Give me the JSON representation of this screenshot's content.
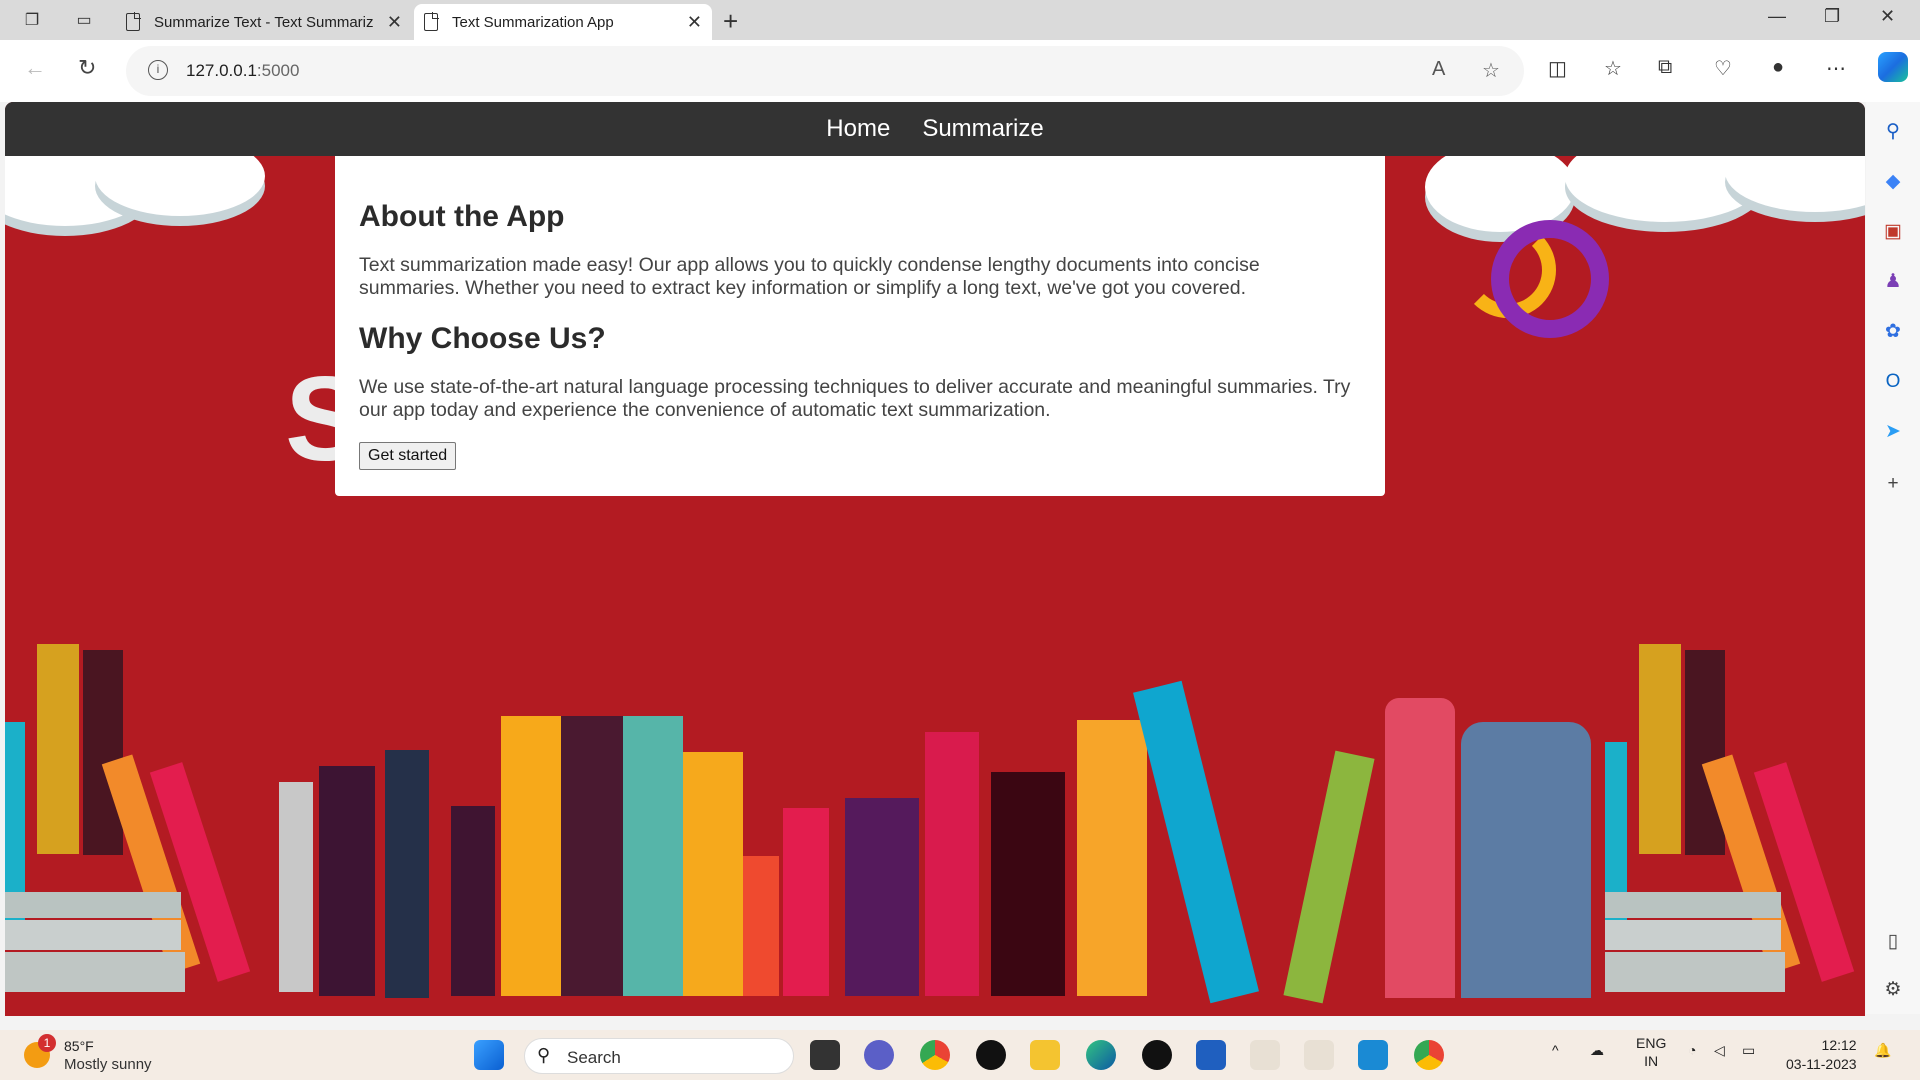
{
  "browser": {
    "tabs": [
      {
        "title": "Summarize Text - Text Summariz",
        "active": false
      },
      {
        "title": "Text Summarization App",
        "active": true
      }
    ],
    "url_host": "127.0.0.1",
    "url_port": ":5000"
  },
  "page": {
    "nav": [
      "Home",
      "Summarize"
    ],
    "bg_text": "SU",
    "about_heading": "About the App",
    "about_text": "Text summarization made easy! Our app allows you to quickly condense lengthy documents into concise summaries. Whether you need to extract key information or simplify a long text, we've got you covered.",
    "why_heading": "Why Choose Us?",
    "why_text": "We use state-of-the-art natural language processing techniques to deliver accurate and meaningful summaries. Try our app today and experience the convenience of automatic text summarization.",
    "button_label": "Get started"
  },
  "taskbar": {
    "weather_badge": "1",
    "temperature": "85°F",
    "condition": "Mostly sunny",
    "search_label": "Search",
    "language": "ENG",
    "region": "IN",
    "time": "12:12",
    "date": "03-11-2023"
  },
  "colors": {
    "page_bg": "#b31b22",
    "navbar": "#333333",
    "accent_ring": "#8a2bb3"
  }
}
